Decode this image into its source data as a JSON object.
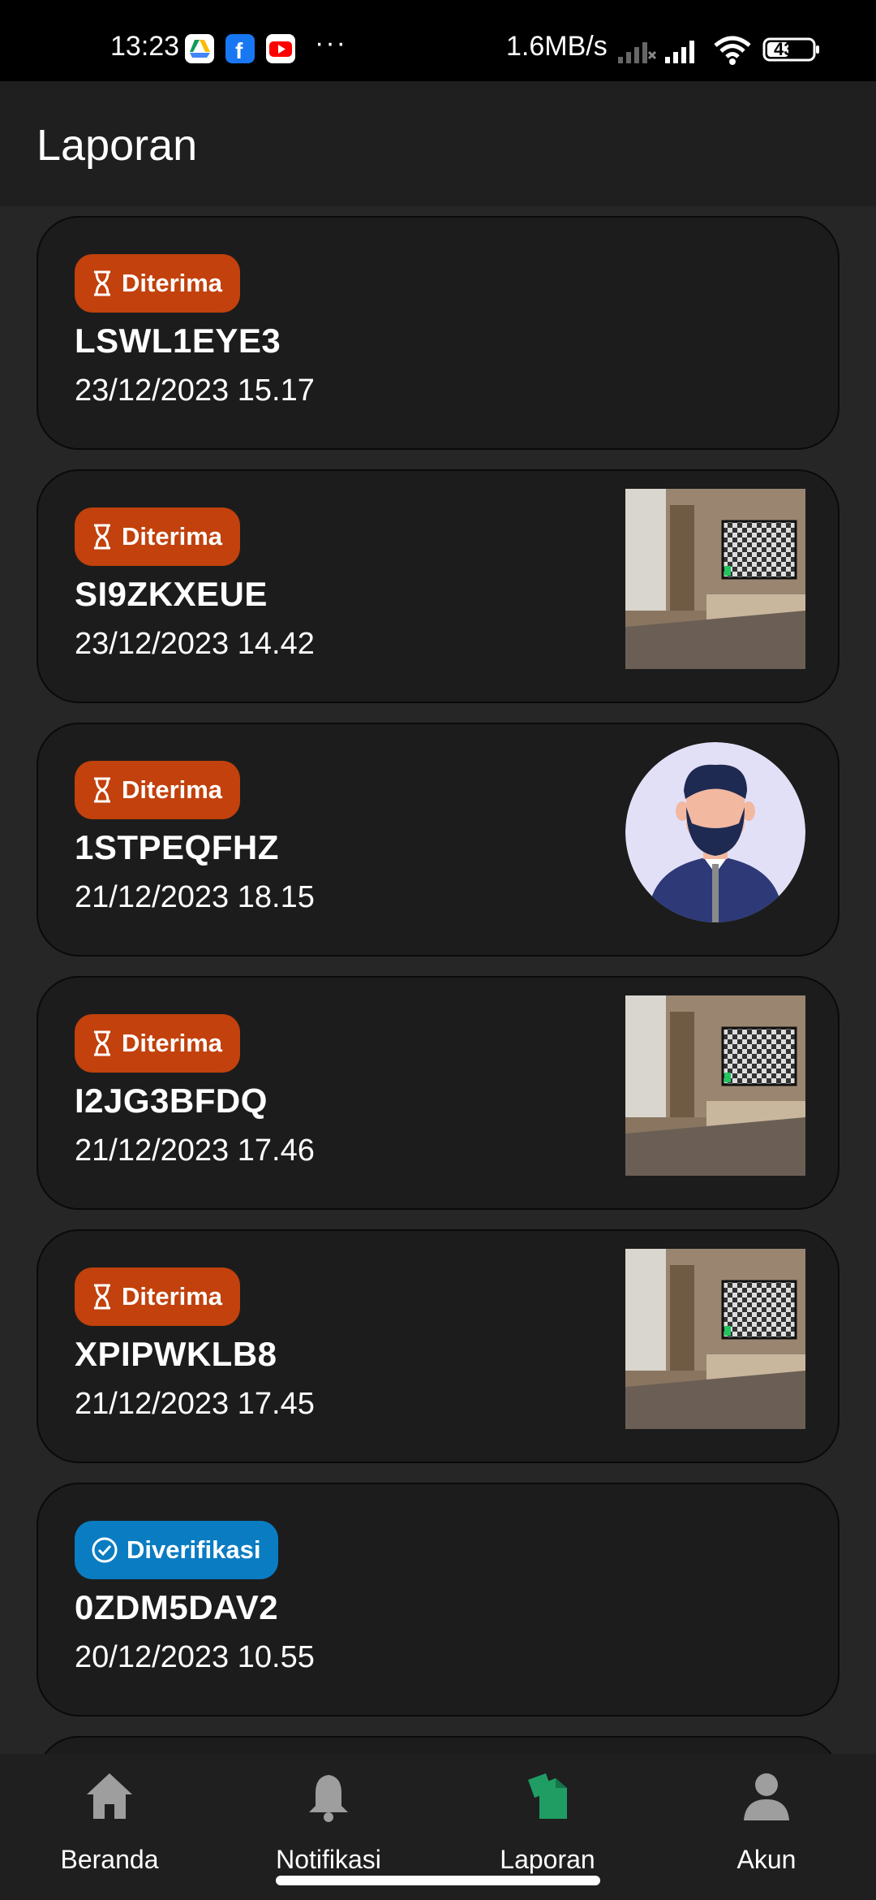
{
  "status_bar": {
    "time": "13:23",
    "app_icons": [
      "drive-icon",
      "facebook-icon",
      "youtube-icon"
    ],
    "more": "···",
    "speed": "1.6MB/s",
    "battery": "43"
  },
  "header": {
    "title": "Laporan"
  },
  "reports": [
    {
      "status": "Diterima",
      "status_type": "received",
      "code": "LSWL1EYE3",
      "date": "23/12/2023 15.17",
      "thumbnail": "none"
    },
    {
      "status": "Diterima",
      "status_type": "received",
      "code": "SI9ZKXEUE",
      "date": "23/12/2023 14.42",
      "thumbnail": "room-photo"
    },
    {
      "status": "Diterima",
      "status_type": "received",
      "code": "1STPEQFHZ",
      "date": "21/12/2023 18.15",
      "thumbnail": "avatar-illustration"
    },
    {
      "status": "Diterima",
      "status_type": "received",
      "code": "I2JG3BFDQ",
      "date": "21/12/2023 17.46",
      "thumbnail": "room-photo"
    },
    {
      "status": "Diterima",
      "status_type": "received",
      "code": "XPIPWKLB8",
      "date": "21/12/2023 17.45",
      "thumbnail": "room-photo"
    },
    {
      "status": "Diverifikasi",
      "status_type": "verified",
      "code": "0ZDM5DAV2",
      "date": "20/12/2023 10.55",
      "thumbnail": "none"
    }
  ],
  "nav": {
    "items": [
      {
        "label": "Beranda",
        "icon": "home-icon",
        "active": false
      },
      {
        "label": "Notifikasi",
        "icon": "bell-icon",
        "active": false
      },
      {
        "label": "Laporan",
        "icon": "documents-icon",
        "active": true
      },
      {
        "label": "Akun",
        "icon": "person-icon",
        "active": false
      }
    ]
  },
  "colors": {
    "received_badge": "#c2410c",
    "verified_badge": "#0a7cc2",
    "active_nav": "#1f9d63",
    "inactive_nav": "#9e9e9e"
  }
}
